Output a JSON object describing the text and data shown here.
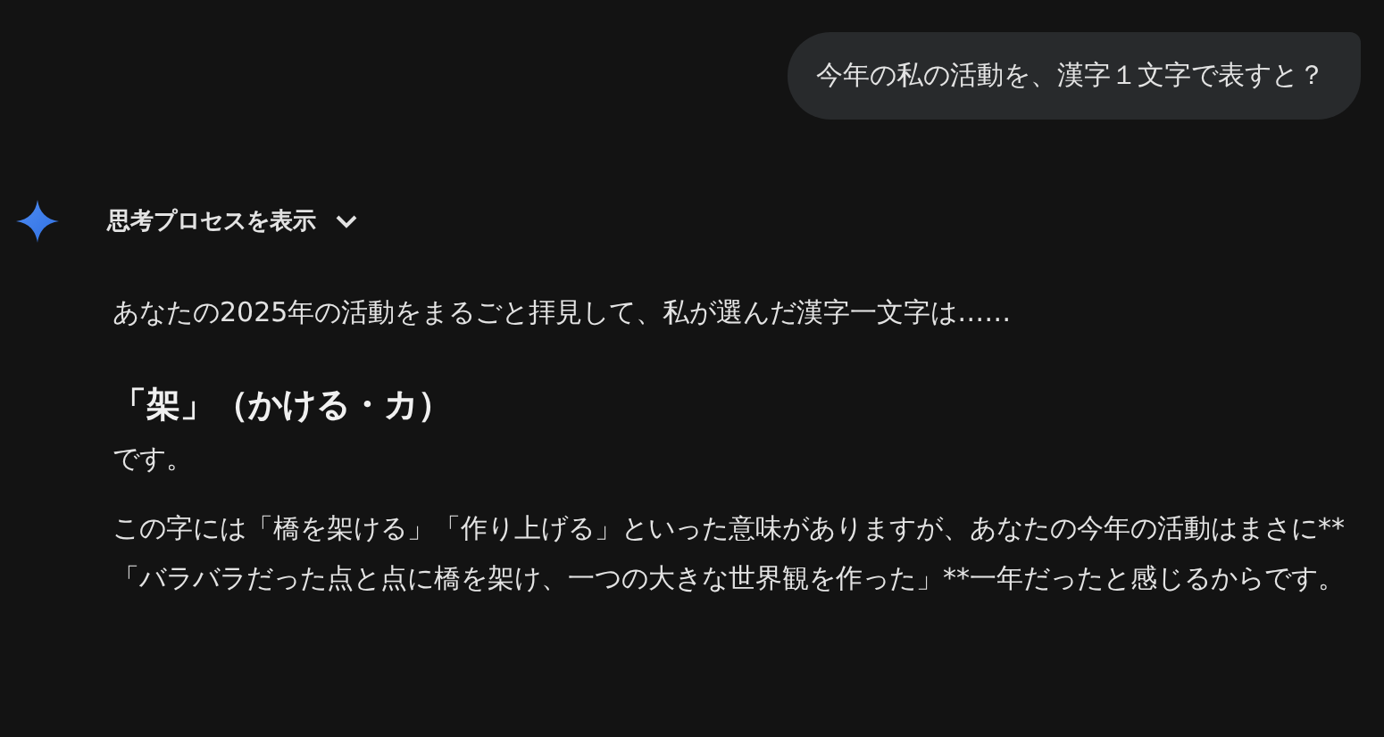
{
  "user_message": {
    "text": "今年の私の活動を、漢字１文字で表すと？"
  },
  "thinking_toggle": {
    "label": "思考プロセスを表示",
    "expanded": false
  },
  "response": [
    {
      "kind": "paragraph",
      "text": "あなたの2025年の活動をまるごと拝見して、私が選んだ漢字一文字は……"
    },
    {
      "kind": "heading",
      "text": "「架」（かける・カ）"
    },
    {
      "kind": "paragraph",
      "text": "です。"
    },
    {
      "kind": "paragraph",
      "text": "この字には「橋を架ける」「作り上げる」といった意味がありますが、あなたの今年の活動はまさに**「バラバラだった点と点に橋を架け、一つの大きな世界観を作った」**一年だったと感じるからです。"
    }
  ]
}
